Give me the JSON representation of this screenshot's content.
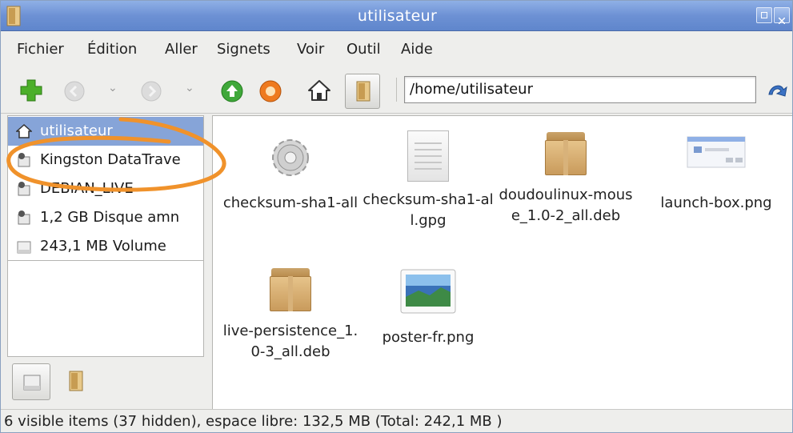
{
  "window": {
    "title": "utilisateur"
  },
  "menu": [
    "Fichier",
    "Édition",
    "Aller",
    "Signets",
    "Voir",
    "Outil",
    "Aide"
  ],
  "toolbar": {
    "address": "/home/utilisateur"
  },
  "sidebar": {
    "places": [
      {
        "label": "utilisateur",
        "icon": "home-icon",
        "selected": true
      },
      {
        "label": "Kingston DataTrave",
        "icon": "usb-drive-icon"
      },
      {
        "label": "DEBIAN_LIVE",
        "icon": "drive-icon"
      },
      {
        "label": "1,2 GB Disque amn",
        "icon": "drive-icon"
      },
      {
        "label": "243,1 MB Volume",
        "icon": "volume-icon"
      }
    ]
  },
  "files": [
    {
      "name": "checksum-sha1-all",
      "icon": "executable-gear-icon"
    },
    {
      "name": "checksum-sha1-all.gpg",
      "icon": "text-document-icon"
    },
    {
      "name": "doudoulinux-mouse_1.0-2_all.deb",
      "icon": "package-box-icon"
    },
    {
      "name": "launch-box.png",
      "icon": "image-thumbnail-icon"
    },
    {
      "name": "live-persistence_1.0-3_all.deb",
      "icon": "package-box-icon"
    },
    {
      "name": "poster-fr.png",
      "icon": "image-thumbnail-icon"
    }
  ],
  "status": "6 visible items (37 hidden), espace libre: 132,5 MB (Total: 242,1 MB )",
  "colors": {
    "titlebar": "#6d91d4",
    "selection": "#86a4d8",
    "annotation": "#f0922b"
  }
}
